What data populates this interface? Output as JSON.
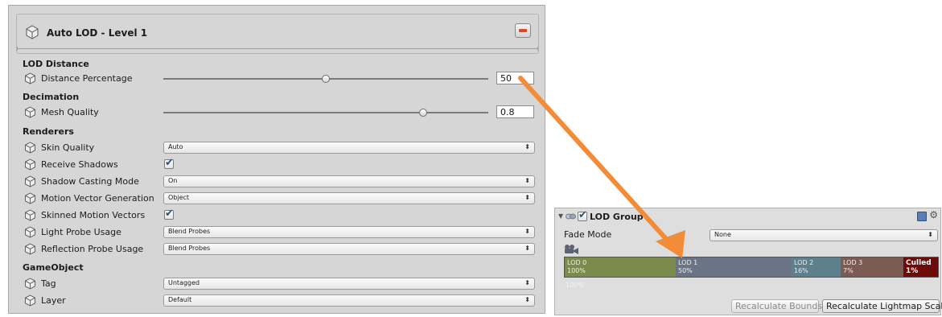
{
  "auto_lod": {
    "title": "Auto LOD - Level 1",
    "sections": {
      "lod_distance": "LOD Distance",
      "decimation": "Decimation",
      "renderers": "Renderers",
      "gameobject": "GameObject"
    },
    "distance_percentage": {
      "label": "Distance Percentage",
      "value": "50",
      "slider_fraction": 0.5
    },
    "mesh_quality": {
      "label": "Mesh Quality",
      "value": "0.8",
      "slider_fraction": 0.8
    },
    "skin_quality": {
      "label": "Skin Quality",
      "value": "Auto"
    },
    "receive_shadows": {
      "label": "Receive Shadows",
      "checked": true
    },
    "shadow_casting_mode": {
      "label": "Shadow Casting Mode",
      "value": "On"
    },
    "motion_vector_generation": {
      "label": "Motion Vector Generation",
      "value": "Object"
    },
    "skinned_motion_vectors": {
      "label": "Skinned Motion Vectors",
      "checked": true
    },
    "light_probe_usage": {
      "label": "Light Probe Usage",
      "value": "Blend Probes"
    },
    "reflection_probe_usage": {
      "label": "Reflection Probe Usage",
      "value": "Blend Probes"
    },
    "tag": {
      "label": "Tag",
      "value": "Untagged"
    },
    "layer": {
      "label": "Layer",
      "value": "Default"
    }
  },
  "lod_group": {
    "title": "LOD Group",
    "enabled": true,
    "fade_mode_label": "Fade Mode",
    "fade_mode_value": "None",
    "levels": [
      {
        "name": "LOD 0",
        "percent": "100%",
        "color": "#7c8b4c"
      },
      {
        "name": "LOD 1",
        "percent": "50%",
        "color": "#6b7486"
      },
      {
        "name": "LOD 2",
        "percent": "16%",
        "color": "#5e7f8c"
      },
      {
        "name": "LOD 3",
        "percent": "7%",
        "color": "#7b5b53"
      },
      {
        "name": "Culled",
        "percent": "1%",
        "color": "#6e0a08"
      }
    ],
    "below_percent": "100%",
    "recalculate_bounds": "Recalculate Bounds",
    "recalculate_lightmap_scale": "Recalculate Lightmap Scale"
  },
  "colors": {
    "arrow": "#f28c38",
    "remove_button": "#e0452a",
    "checkbox_tick": "#2a4f8a"
  }
}
